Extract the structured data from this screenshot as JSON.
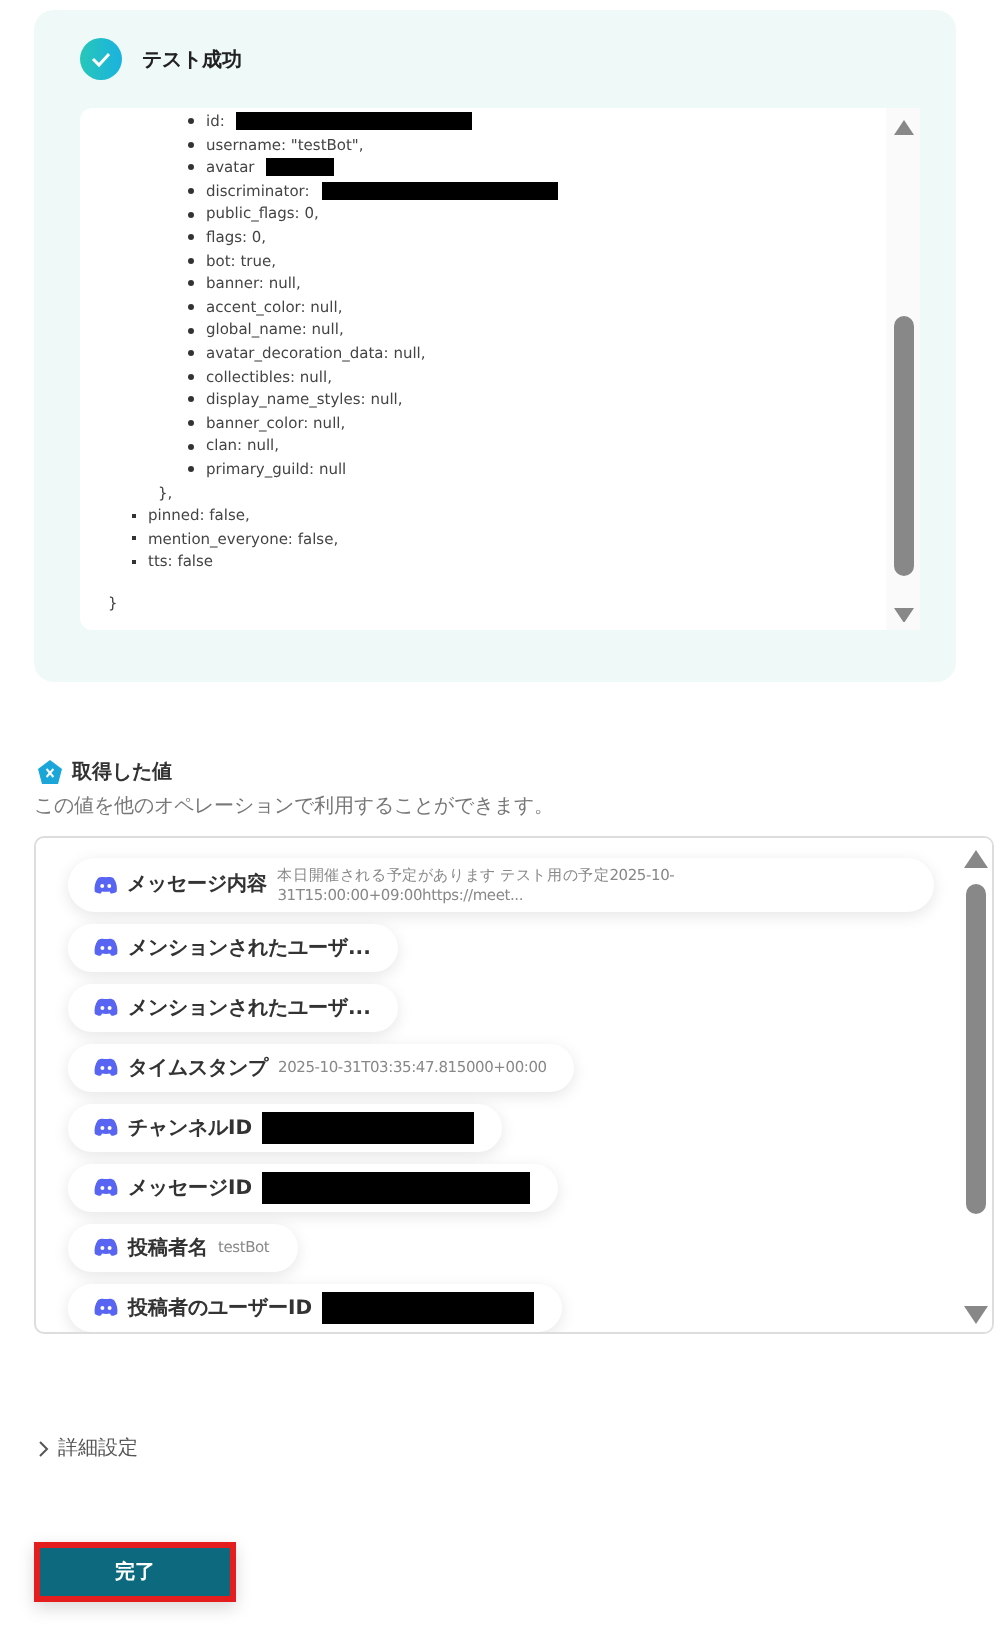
{
  "test_result": {
    "title": "テスト成功",
    "success": true,
    "inner_lines": [
      {
        "text": "id:",
        "redacted": true
      },
      {
        "text": "username: \"testBot\","
      },
      {
        "text": "avatar",
        "redacted": true
      },
      {
        "text": "discriminator:",
        "redacted": true
      },
      {
        "text": "public_flags: 0,"
      },
      {
        "text": "flags: 0,"
      },
      {
        "text": "bot: true,"
      },
      {
        "text": "banner: null,"
      },
      {
        "text": "accent_color: null,"
      },
      {
        "text": "global_name: null,"
      },
      {
        "text": "avatar_decoration_data: null,"
      },
      {
        "text": "collectibles: null,"
      },
      {
        "text": "display_name_styles: null,"
      },
      {
        "text": "banner_color: null,"
      },
      {
        "text": "clan: null,"
      },
      {
        "text": "primary_guild: null"
      }
    ],
    "inner_close": "},",
    "outer_lines": [
      "pinned: false,",
      "mention_everyone: false,",
      "tts: false"
    ],
    "close": "}"
  },
  "values": {
    "title": "取得した値",
    "subtitle": "この値を他のオペレーションで利用することができます。",
    "items": [
      {
        "label": "メッセージ内容",
        "value": "本日開催される予定があります テスト用の予定2025-10-31T15:00:00+09:00https://meet..."
      },
      {
        "label": "メンションされたユーザ..."
      },
      {
        "label": "メンションされたユーザ..."
      },
      {
        "label": "タイムスタンプ",
        "value": "2025-10-31T03:35:47.815000+00:00"
      },
      {
        "label": "チャンネルID",
        "redacted": true
      },
      {
        "label": "メッセージID",
        "redacted": true
      },
      {
        "label": "投稿者名",
        "value": "testBot"
      },
      {
        "label": "投稿者のユーザーID",
        "redacted": true
      }
    ]
  },
  "advanced": {
    "label": "詳細設定",
    "expanded": false
  },
  "done_button": "完了"
}
